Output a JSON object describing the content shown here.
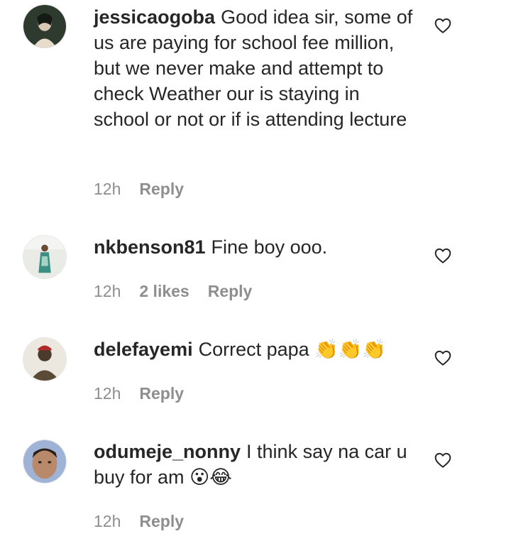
{
  "comments": [
    {
      "username": "jessicaogoba",
      "text": "Good idea sir, some of us are paying for school fee million, but we never make and attempt to check Weather our is staying in school or not or if is attending lecture",
      "time": "12h",
      "reply_label": "Reply",
      "avatar_colors": [
        "#2f3a2f",
        "#d9c9b4"
      ]
    },
    {
      "username": "nkbenson81",
      "text": "Fine boy ooo.",
      "time": "12h",
      "likes": "2 likes",
      "reply_label": "Reply",
      "avatar_colors": [
        "#e9ece6",
        "#3c8f83"
      ]
    },
    {
      "username": "delefayemi",
      "text": "Correct papa",
      "emoji": "👏👏👏",
      "time": "12h",
      "reply_label": "Reply",
      "avatar_colors": [
        "#ece7df",
        "#4a3a2c"
      ]
    },
    {
      "username": "odumeje_nonny",
      "text": "I think say na car u buy for am",
      "emoji": "😮😂",
      "time": "12h",
      "reply_label": "Reply",
      "avatar_colors": [
        "#b8896a",
        "#7a8fb8"
      ]
    }
  ],
  "icons": {
    "like": "heart-outline-icon"
  },
  "colors": {
    "text": "#262626",
    "meta": "#8e8e8e"
  }
}
